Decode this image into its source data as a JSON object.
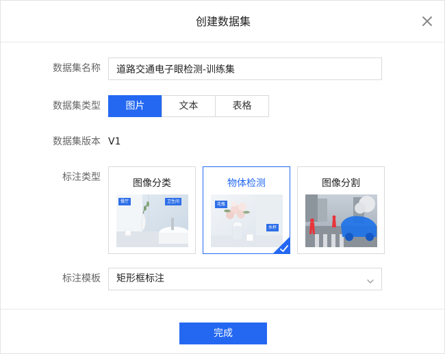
{
  "dialog": {
    "title": "创建数据集",
    "close_icon": "close-icon"
  },
  "form": {
    "name": {
      "label": "数据集名称",
      "value": "道路交通电子眼检测-训练集"
    },
    "type": {
      "label": "数据集类型",
      "options": [
        "图片",
        "文本",
        "表格"
      ],
      "selected": "图片"
    },
    "version": {
      "label": "数据集版本",
      "value": "V1"
    },
    "annotation_type": {
      "label": "标注类型",
      "cards": [
        {
          "title": "图像分类",
          "tags": [
            "餐厅",
            "卫生间"
          ]
        },
        {
          "title": "物体检测",
          "tags": [
            "花瓶",
            "水杯"
          ]
        },
        {
          "title": "图像分割",
          "tags": []
        }
      ],
      "selected": "物体检测"
    },
    "template": {
      "label": "标注模板",
      "value": "矩形框标注"
    }
  },
  "footer": {
    "submit_label": "完成"
  },
  "colors": {
    "primary": "#2468f2",
    "border": "#d9d9d9",
    "label": "#666666"
  }
}
